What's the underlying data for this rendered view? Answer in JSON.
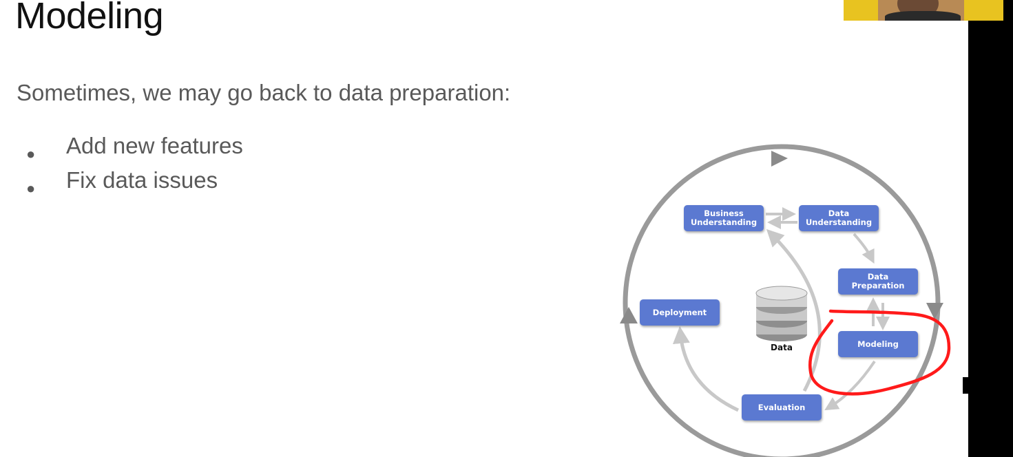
{
  "slide": {
    "title": "Modeling",
    "subtitle": "Sometimes, we may go back to data preparation:",
    "bullets": [
      "Add new features",
      "Fix data issues"
    ],
    "bullet_glyph": "●"
  },
  "diagram": {
    "boxes": {
      "business": "Business\nUnderstanding",
      "data_understanding": "Data\nUnderstanding",
      "data_preparation": "Data\nPreparation",
      "modeling": "Modeling",
      "evaluation": "Evaluation",
      "deployment": "Deployment"
    },
    "database_label": "Data"
  },
  "colors": {
    "box_fill": "#5b79d1",
    "arrow_light": "#c8c8c8",
    "cycle_ring": "#9a9a9a",
    "annotation": "#ff1a1a"
  },
  "webcam": {
    "icon": "webcam-thumbnail"
  }
}
